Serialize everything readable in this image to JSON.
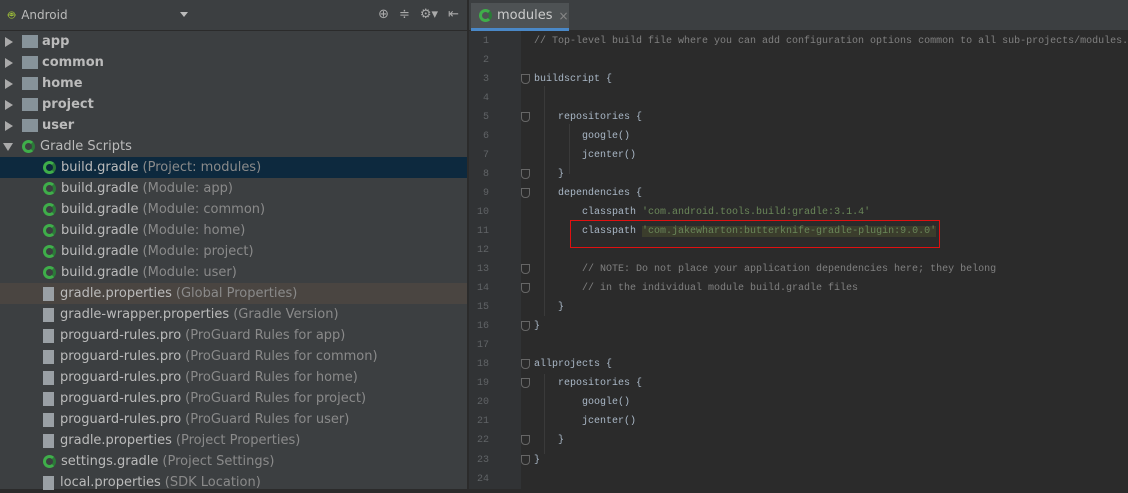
{
  "project_view": {
    "selector": "Android",
    "tools": [
      "⊕",
      "≑",
      "⚙▾",
      "⇤"
    ]
  },
  "tree": [
    {
      "label": "app",
      "bold": true,
      "kind": "folder",
      "state": "c"
    },
    {
      "label": "common",
      "bold": true,
      "kind": "folder",
      "state": "c"
    },
    {
      "label": "home",
      "bold": true,
      "kind": "folder",
      "state": "c"
    },
    {
      "label": "project",
      "bold": true,
      "kind": "folder",
      "state": "c"
    },
    {
      "label": "user",
      "bold": true,
      "kind": "folder",
      "state": "c"
    },
    {
      "label": "Gradle Scripts",
      "kind": "gradle",
      "state": "o",
      "indent": 0
    },
    {
      "label": "build.gradle",
      "ann": "(Project: modules)",
      "kind": "gradle",
      "sel": true
    },
    {
      "label": "build.gradle",
      "ann": "(Module: app)",
      "kind": "gradle"
    },
    {
      "label": "build.gradle",
      "ann": "(Module: common)",
      "kind": "gradle"
    },
    {
      "label": "build.gradle",
      "ann": "(Module: home)",
      "kind": "gradle"
    },
    {
      "label": "build.gradle",
      "ann": "(Module: project)",
      "kind": "gradle"
    },
    {
      "label": "build.gradle",
      "ann": "(Module: user)",
      "kind": "gradle"
    },
    {
      "label": "gradle.properties",
      "ann": "(Global Properties)",
      "kind": "file",
      "hl": true
    },
    {
      "label": "gradle-wrapper.properties",
      "ann": "(Gradle Version)",
      "kind": "file"
    },
    {
      "label": "proguard-rules.pro",
      "ann": "(ProGuard Rules for app)",
      "kind": "file"
    },
    {
      "label": "proguard-rules.pro",
      "ann": "(ProGuard Rules for common)",
      "kind": "file"
    },
    {
      "label": "proguard-rules.pro",
      "ann": "(ProGuard Rules for home)",
      "kind": "file"
    },
    {
      "label": "proguard-rules.pro",
      "ann": "(ProGuard Rules for project)",
      "kind": "file"
    },
    {
      "label": "proguard-rules.pro",
      "ann": "(ProGuard Rules for user)",
      "kind": "file"
    },
    {
      "label": "gradle.properties",
      "ann": "(Project Properties)",
      "kind": "file"
    },
    {
      "label": "settings.gradle",
      "ann": "(Project Settings)",
      "kind": "gradle"
    },
    {
      "label": "local.properties",
      "ann": "(SDK Location)",
      "kind": "file"
    }
  ],
  "editor": {
    "tab": "modules",
    "close": "×"
  },
  "lines": [
    [
      [
        "// Top-level build file where you can add configuration options common to all sub-projects/modules.",
        "cm"
      ]
    ],
    [],
    [
      [
        "buildscript {",
        ""
      ]
    ],
    [],
    [
      [
        "    repositories {",
        ""
      ]
    ],
    [
      [
        "        google()",
        ""
      ]
    ],
    [
      [
        "        jcenter()",
        ""
      ]
    ],
    [
      [
        "    }",
        ""
      ]
    ],
    [
      [
        "    dependencies {",
        ""
      ]
    ],
    [
      [
        "        classpath ",
        ""
      ],
      [
        "'com.android.tools.build:gradle:3.1.4'",
        "st"
      ]
    ],
    [
      [
        "        classpath ",
        ""
      ],
      [
        "'com.jakewharton:butterknife-gradle-plugin:9.0.0'",
        "sth"
      ]
    ],
    [],
    [
      [
        "        // NOTE: Do not place your application dependencies here; they belong",
        "cm"
      ]
    ],
    [
      [
        "        // in the individual module build.gradle files",
        "cm"
      ]
    ],
    [
      [
        "    }",
        ""
      ]
    ],
    [
      [
        "}",
        ""
      ]
    ],
    [],
    [
      [
        "allprojects {",
        ""
      ]
    ],
    [
      [
        "    repositories {",
        ""
      ]
    ],
    [
      [
        "        google()",
        ""
      ]
    ],
    [
      [
        "        jcenter()",
        ""
      ]
    ],
    [
      [
        "    }",
        ""
      ]
    ],
    [
      [
        "}",
        ""
      ]
    ],
    []
  ],
  "colors": {
    "string": "#6a8759",
    "comment": "#808080",
    "highlight_box": "#e01010"
  }
}
